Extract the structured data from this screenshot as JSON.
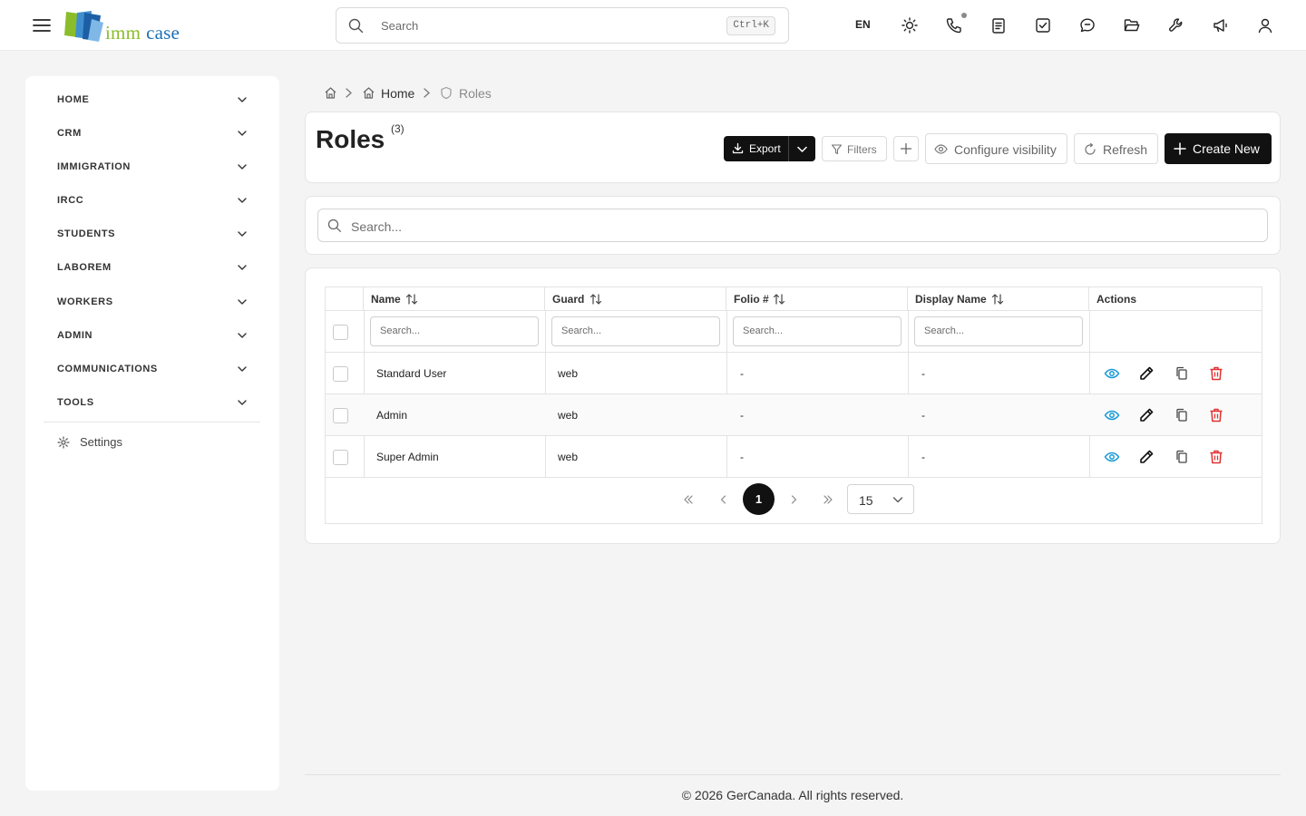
{
  "app": {
    "logo_text_1": "imm",
    "logo_text_2": "case",
    "search_placeholder": "Search",
    "search_shortcut": "Ctrl+K",
    "language": "EN",
    "top_icons": [
      "sun-icon",
      "phone-icon",
      "clipboard-icon",
      "checkbox-icon",
      "chat-icon",
      "folder-open-icon",
      "wrench-icon",
      "megaphone-icon",
      "user-icon"
    ]
  },
  "sidebar": {
    "items": [
      {
        "label": "HOME"
      },
      {
        "label": "CRM"
      },
      {
        "label": "IMMIGRATION"
      },
      {
        "label": "IRCC"
      },
      {
        "label": "STUDENTS"
      },
      {
        "label": "LABOREM"
      },
      {
        "label": "WORKERS"
      },
      {
        "label": "ADMIN"
      },
      {
        "label": "COMMUNICATIONS"
      },
      {
        "label": "TOOLS"
      }
    ],
    "settings": "Settings"
  },
  "breadcrumb": {
    "home": "Home",
    "current": "Roles"
  },
  "page": {
    "title": "Roles",
    "count": "(3)",
    "export": "Export",
    "filters": "Filters",
    "configure": "Configure visibility",
    "refresh": "Refresh",
    "create": "Create New",
    "search_placeholder": "Search..."
  },
  "table": {
    "columns": [
      "Name",
      "Guard",
      "Folio #",
      "Display Name",
      "Actions"
    ],
    "filter_placeholder": "Search...",
    "rows": [
      {
        "name": "Standard User",
        "guard": "web",
        "folio": "-",
        "display": "-"
      },
      {
        "name": "Admin",
        "guard": "web",
        "folio": "-",
        "display": "-"
      },
      {
        "name": "Super Admin",
        "guard": "web",
        "folio": "-",
        "display": "-"
      }
    ]
  },
  "pagination": {
    "current_page": "1",
    "per_page": "15"
  },
  "footer": {
    "copyright": "© 2026 GerCanada. All rights reserved."
  },
  "colors": {
    "view_icon": "#1a9bd7",
    "delete_icon": "#e03131",
    "primary": "#111111"
  }
}
